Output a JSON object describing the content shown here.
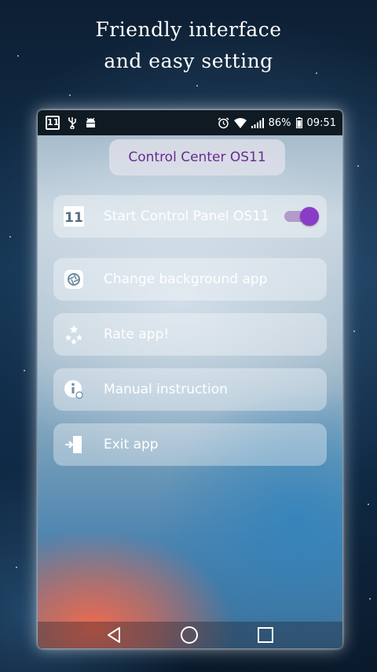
{
  "promo": {
    "line1": "Friendly interface",
    "line2": "and easy setting"
  },
  "statusbar": {
    "left_badge": "11",
    "icons_left": [
      "usb-icon",
      "android-icon"
    ],
    "icons_right": [
      "alarm-icon",
      "wifi-icon",
      "signal-icon"
    ],
    "battery": "86%",
    "time": "09:51"
  },
  "app": {
    "title": "Control Center OS11",
    "menu": [
      {
        "label": "Start Control Panel OS11",
        "icon": "os11-icon",
        "toggle_on": true
      },
      {
        "label": "Change background app",
        "icon": "shutter-icon"
      },
      {
        "label": "Rate app!",
        "icon": "rate-stars-icon"
      },
      {
        "label": "Manual instruction",
        "icon": "info-icon"
      },
      {
        "label": "Exit app",
        "icon": "exit-icon"
      }
    ],
    "os11_badge": "11",
    "accent_color": "#8a3cc6"
  },
  "navbar": {
    "buttons": [
      "back-icon",
      "home-icon",
      "recents-icon"
    ]
  }
}
